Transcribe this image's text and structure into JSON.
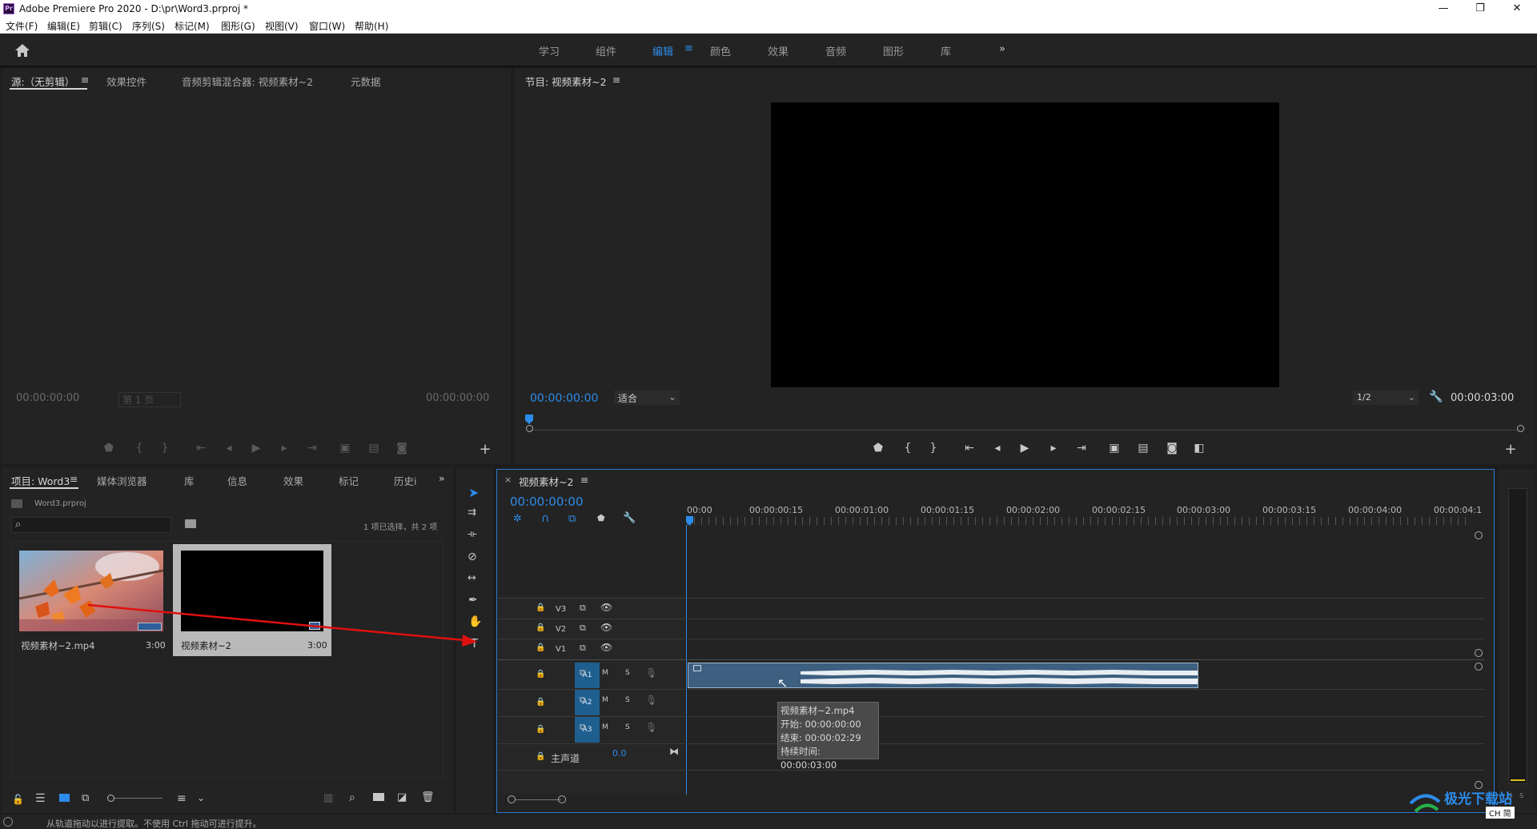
{
  "app": {
    "title": "Adobe Premiere Pro 2020 - D:\\pr\\Word3.prproj *",
    "icon_text": "Pr"
  },
  "window_controls": [
    "—",
    "❐",
    "✕"
  ],
  "menu": [
    "文件(F)",
    "编辑(E)",
    "剪辑(C)",
    "序列(S)",
    "标记(M)",
    "图形(G)",
    "视图(V)",
    "窗口(W)",
    "帮助(H)"
  ],
  "workspaces": {
    "items": [
      "学习",
      "组件",
      "编辑",
      "颜色",
      "效果",
      "音频",
      "图形",
      "库"
    ],
    "active": "编辑",
    "more": "»"
  },
  "source_panel": {
    "tabs": [
      "源:（无剪辑）",
      "效果控件",
      "音频剪辑混合器: 视频素材~2",
      "元数据"
    ],
    "timecode_left": "00:00:00:00",
    "page_select": "第 1 页",
    "timecode_right": "00:00:00:00"
  },
  "program_panel": {
    "title": "节目: 视频素材~2",
    "timecode": "00:00:00:00",
    "fit": "适合",
    "resolution": "1/2",
    "duration": "00:00:03:00"
  },
  "project_panel": {
    "tabs": [
      "项目: Word3",
      "媒体浏览器",
      "库",
      "信息",
      "效果",
      "标记",
      "历史i"
    ],
    "file": "Word3.prproj",
    "selection_status": "1 项已选择，共 2 项",
    "search_placeholder": "",
    "items": [
      {
        "name": "视频素材~2.mp4",
        "duration": "3:00"
      },
      {
        "name": "视频素材~2",
        "duration": "3:00"
      }
    ]
  },
  "timeline": {
    "sequence_name": "视频素材~2",
    "timecode": "00:00:00:00",
    "ruler": [
      "00:00",
      "00:00:00:15",
      "00:00:01:00",
      "00:00:01:15",
      "00:00:02:00",
      "00:00:02:15",
      "00:00:03:00",
      "00:00:03:15",
      "00:00:04:00",
      "00:00:04:1"
    ],
    "video_tracks": [
      "V3",
      "V2",
      "V1"
    ],
    "audio_tracks": [
      "A1",
      "A2",
      "A3"
    ],
    "mute": "M",
    "solo": "S",
    "master": {
      "label": "主声道",
      "value": "0.0"
    },
    "tooltip": {
      "name": "视频素材~2.mp4",
      "start": "开始: 00:00:00:00",
      "end": "结束: 00:00:02:29",
      "duration": "持续时间: 00:00:03:00"
    }
  },
  "status_bar": "从轨道拖动以进行提取。不使用 Ctrl 拖动可进行提升。",
  "meters": {
    "labels": [
      "S",
      "S"
    ]
  },
  "watermark": {
    "text": "极光下载站",
    "ime": "CH 简"
  },
  "colors": {
    "accent": "#2d8ceb",
    "panel": "#232323",
    "track_selected": "#1f5f8f",
    "arrow": "#e01010"
  }
}
